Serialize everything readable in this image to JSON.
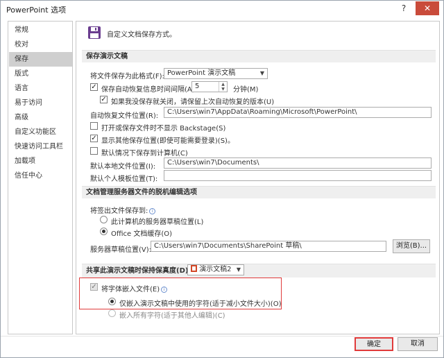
{
  "window": {
    "title": "PowerPoint 选项",
    "help_glyph": "?",
    "close_glyph": "✕"
  },
  "sidebar": {
    "items": [
      {
        "label": "常规"
      },
      {
        "label": "校对"
      },
      {
        "label": "保存"
      },
      {
        "label": "版式"
      },
      {
        "label": "语言"
      },
      {
        "label": "易于访问"
      },
      {
        "label": "高级"
      },
      {
        "label": "自定义功能区"
      },
      {
        "label": "快速访问工具栏"
      },
      {
        "label": "加载项"
      },
      {
        "label": "信任中心"
      }
    ],
    "selected": "保存"
  },
  "header": {
    "text": "自定义文档保存方式。"
  },
  "save_section": {
    "title": "保存演示文稿",
    "format_label": "将文件保存为此格式(F):",
    "format_value": "PowerPoint 演示文稿",
    "autorecover_label": "保存自动恢复信息时间间隔(A)",
    "autorecover_checked": true,
    "autorecover_minutes": "5",
    "minutes_label": "分钟(M)",
    "keep_last_label": "如果我没保存就关闭，请保留上次自动恢复的版本(U)",
    "keep_last_checked": true,
    "autorecover_path_label": "自动恢复文件位置(R):",
    "autorecover_path": "C:\\Users\\win7\\AppData\\Roaming\\Microsoft\\PowerPoint\\",
    "no_backstage_label": "打开或保存文件时不显示 Backstage(S)",
    "no_backstage_checked": false,
    "show_more_label": "显示其他保存位置(即使可能需要登录)(S)。",
    "show_more_checked": true,
    "save_to_computer_label": "默认情况下保存到计算机(C)",
    "save_to_computer_checked": false,
    "local_path_label": "默认本地文件位置(I):",
    "local_path": "C:\\Users\\win7\\Documents\\",
    "template_path_label": "默认个人模板位置(T):",
    "template_path": ""
  },
  "server_section": {
    "title": "文档管理服务器文件的脱机编辑选项",
    "save_checked_out_label": "将签出文件保存到:",
    "option_server_label": "此计算机的服务器草稿位置(L)",
    "option_office_label": "Office 文档缓存(O)",
    "selected_option": "office",
    "drafts_label": "服务器草稿位置(V):",
    "drafts_path": "C:\\Users\\win7\\Documents\\SharePoint 草稿\\",
    "browse_label": "浏览(B)..."
  },
  "fidelity_section": {
    "title": "共享此演示文稿时保持保真度(D):",
    "doc_value": "演示文稿2",
    "embed_fonts_label": "将字体嵌入文件(E)",
    "embed_fonts_checked": true,
    "embed_used_label": "仅嵌入演示文稿中使用的字符(适于减小文件大小)(O)",
    "embed_all_label": "嵌入所有字符(适于其他人编辑)(C)",
    "selected_embed": "used"
  },
  "footer": {
    "ok_label": "确定",
    "cancel_label": "取消"
  },
  "colors": {
    "highlight_border": "#e03a3a",
    "selected_sidebar": "#cfcfcf",
    "section_header": "#efefef"
  }
}
